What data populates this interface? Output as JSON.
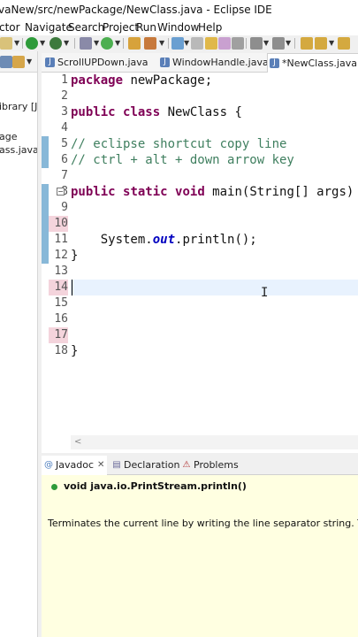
{
  "window": {
    "title": "vaNew/src/newPackage/NewClass.java - Eclipse IDE"
  },
  "menu": {
    "items": [
      "ctor",
      "Navigate",
      "Search",
      "Project",
      "Run",
      "Window",
      "Help"
    ]
  },
  "package_explorer": {
    "items": [
      "ibrary [Ja",
      "age",
      "ass.java"
    ]
  },
  "editor_tabs": [
    {
      "label": "ScrollUPDown.java",
      "active": false
    },
    {
      "label": "WindowHandle.java",
      "active": false
    },
    {
      "label": "*NewClass.java",
      "active": true
    }
  ],
  "code": {
    "line_numbers": [
      "1",
      "2",
      "3",
      "4",
      "5",
      "6",
      "7",
      "8",
      "9",
      "10",
      "11",
      "12",
      "13",
      "14",
      "15",
      "16",
      "17",
      "18"
    ],
    "line1_kw": "package",
    "line1_rest": " newPackage;",
    "line3_kw1": "public",
    "line3_kw2": "class",
    "line3_rest": " NewClass {",
    "line5_comment": "// eclipse shortcut copy line",
    "line6_comment": "// ctrl + alt + down arrow key",
    "line8_kw1": "public",
    "line8_kw2": "static",
    "line8_kw3": "void",
    "line8_rest": " main(String[] args) {",
    "line11_pre": "    System.",
    "line11_field": "out",
    "line11_post": ".println();",
    "line12_text": "}",
    "line18_text": "}"
  },
  "bottom_tabs": [
    {
      "label": "Javadoc",
      "icon": "at-icon"
    },
    {
      "label": "Declaration",
      "icon": "declaration-icon"
    },
    {
      "label": "Problems",
      "icon": "problems-icon"
    }
  ],
  "javadoc": {
    "signature": "void java.io.PrintStream.println()",
    "description": "Terminates the current line by writing the line separator string. The line separator string is defined by the system property"
  }
}
